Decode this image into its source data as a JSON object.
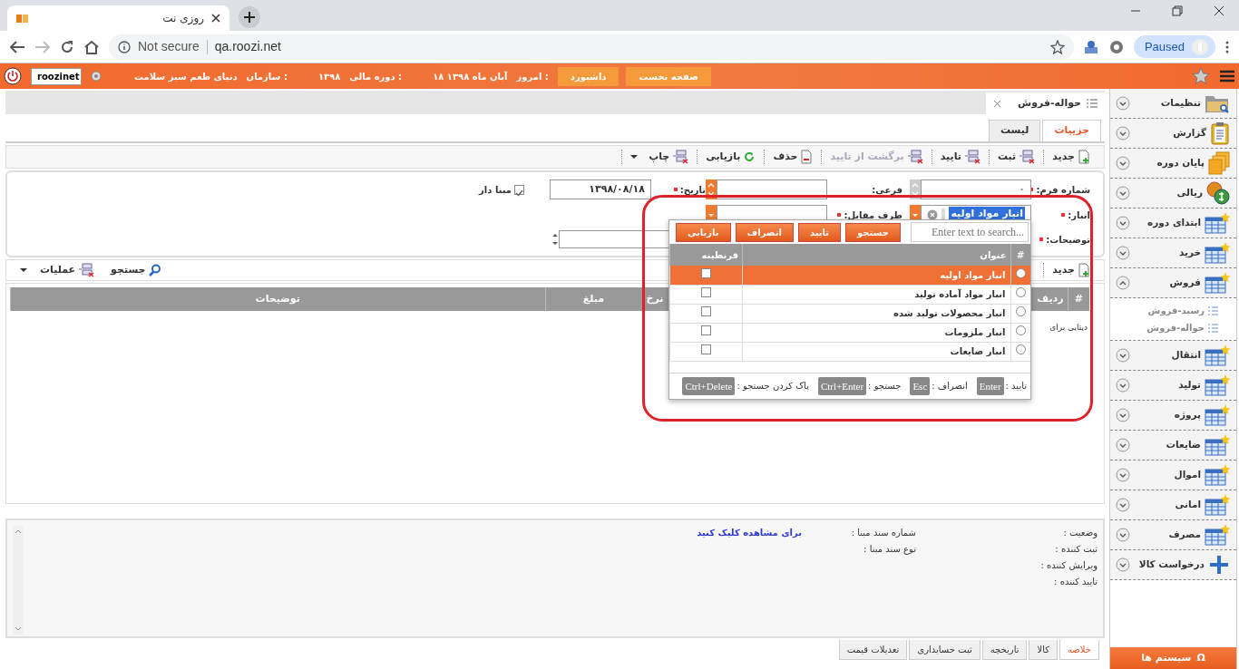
{
  "browser": {
    "tab_title": "روزی نت",
    "security": "Not secure",
    "url": "qa.roozi.net",
    "profile_status": "Paused"
  },
  "header": {
    "user": "roozinet",
    "org_label": "سازمان :",
    "org": "دنیای طعم سبز سلامت",
    "fiscal_label": "دوره مالی :",
    "fiscal_year": "۱۳۹۸",
    "today_label": "امروز :",
    "today": "۱۸ آبان ماه ۱۳۹۸",
    "buttons": [
      "صفحه نخست",
      "داشبورد"
    ]
  },
  "page_tab": {
    "title": "حواله-فروش"
  },
  "view_tabs": [
    {
      "label": "جزییات",
      "selected": true
    },
    {
      "label": "لیست",
      "selected": false
    }
  ],
  "toolbar": [
    {
      "kind": "new",
      "label": "جدید",
      "disabled": false,
      "menu": false
    },
    {
      "kind": "form",
      "label": "ثبت",
      "disabled": false,
      "menu": false
    },
    {
      "kind": "form",
      "label": "تایید",
      "disabled": false,
      "menu": false
    },
    {
      "kind": "form",
      "label": "برگشت از تایید",
      "disabled": true,
      "menu": false
    },
    {
      "kind": "delete",
      "label": "حذف",
      "disabled": false,
      "menu": false
    },
    {
      "kind": "refresh",
      "label": "بازیابی",
      "disabled": false,
      "menu": false
    },
    {
      "kind": "form",
      "label": "چاپ",
      "disabled": false,
      "menu": true
    }
  ],
  "form": {
    "rows": [
      [
        {
          "kind": "spin",
          "label": "شماره فرم:",
          "required": true,
          "disabled": true,
          "value": "۰"
        },
        {
          "kind": "spin",
          "label": "فرعی:",
          "required": false,
          "disabled": false
        },
        {
          "kind": "text",
          "label": "تاریخ:",
          "required": true,
          "value": "۱۳۹۸/۰۸/۱۸"
        },
        {
          "kind": "checkbox",
          "label": "مبنا دار",
          "checked": true
        }
      ],
      [
        {
          "kind": "combo",
          "label": "انبار:",
          "required": true,
          "value": "انبار مواد اولیه",
          "highlighted": true
        },
        {
          "kind": "combo",
          "label": "طرف مقابل:",
          "required": true
        }
      ],
      [
        {
          "kind": "textarea",
          "label": "توضیحات:",
          "required": true
        }
      ]
    ]
  },
  "grid": {
    "toolbar": [
      {
        "kind": "new",
        "label": "جدید",
        "menu": false
      },
      {
        "kind": "search",
        "label": "جستجو",
        "menu": false
      },
      {
        "kind": "form",
        "label": "عملیات",
        "menu": true
      }
    ],
    "columns": [
      "#",
      "ردیف",
      "نرخ",
      "مبلغ",
      "توضیحات"
    ],
    "empty_text": "دیتایی برای"
  },
  "popup": {
    "search": {
      "placeholder": "Enter text to search..."
    },
    "buttons": [
      "جستجو",
      "تایید",
      "انصراف",
      "بازیابی"
    ],
    "columns": [
      "#",
      "عنوان",
      "قرنطینه"
    ],
    "rows": [
      {
        "title": "انبار مواد اولیه",
        "selected": true,
        "quarantine": false
      },
      {
        "title": "انبار مواد آماده تولید",
        "selected": false,
        "quarantine": false
      },
      {
        "title": "انبار محصولات تولید شده",
        "selected": false,
        "quarantine": false
      },
      {
        "title": "انبار ملزومات",
        "selected": false,
        "quarantine": false
      },
      {
        "title": "انبار ضایعات",
        "selected": false,
        "quarantine": false
      }
    ],
    "shortcuts": [
      {
        "label": "تایید :",
        "key": "Enter"
      },
      {
        "label": "انصراف :",
        "key": "Esc"
      },
      {
        "label": "جستجو :",
        "key": "Ctrl+Enter"
      },
      {
        "label": "پاک کردن جستجو :",
        "key": "Ctrl+Delete"
      }
    ]
  },
  "info": {
    "status_labels": [
      "وضعیت :",
      "ثبت کننده :",
      "ویرایش کننده :",
      "تایید کننده :"
    ],
    "source_labels": [
      "شماره سند مبنا :",
      "نوع سند مبنا :"
    ],
    "link": "برای مشاهده کلیک کنید"
  },
  "bottom_tabs": [
    {
      "label": "خلاصه",
      "selected": true
    },
    {
      "label": "کالا",
      "selected": false
    },
    {
      "label": "تاریخچه",
      "selected": false
    },
    {
      "label": "ثبت حسابداری",
      "selected": false
    },
    {
      "label": "تعدیلات قیمت",
      "selected": false
    }
  ],
  "sidebar": {
    "items": [
      {
        "kind": "folder",
        "label": "تنظیمات",
        "expanded": false
      },
      {
        "kind": "clipboard",
        "label": "گزارش",
        "expanded": false
      },
      {
        "kind": "stack",
        "label": "پایان دوره",
        "expanded": false
      },
      {
        "kind": "coins",
        "label": "ریالی",
        "expanded": false
      },
      {
        "kind": "table",
        "label": "ابتدای دوره",
        "expanded": false
      },
      {
        "kind": "table",
        "label": "خرید",
        "expanded": false
      },
      {
        "kind": "table",
        "label": "فروش",
        "expanded": true,
        "children": [
          {
            "label": "رسید-فروش"
          },
          {
            "label": "حواله-فروش"
          }
        ]
      },
      {
        "kind": "table",
        "label": "انتقال",
        "expanded": false
      },
      {
        "kind": "table",
        "label": "تولید",
        "expanded": false
      },
      {
        "kind": "table",
        "label": "پروژه",
        "expanded": false
      },
      {
        "kind": "table",
        "label": "ضایعات",
        "expanded": false
      },
      {
        "kind": "table",
        "label": "اموال",
        "expanded": false
      },
      {
        "kind": "table",
        "label": "امانی",
        "expanded": false
      },
      {
        "kind": "table",
        "label": "مصرف",
        "expanded": false
      },
      {
        "kind": "plus",
        "label": "درخواست کالا",
        "expanded": false
      }
    ],
    "footer": {
      "symbol": "Ω",
      "label": "سیستم ها"
    }
  }
}
